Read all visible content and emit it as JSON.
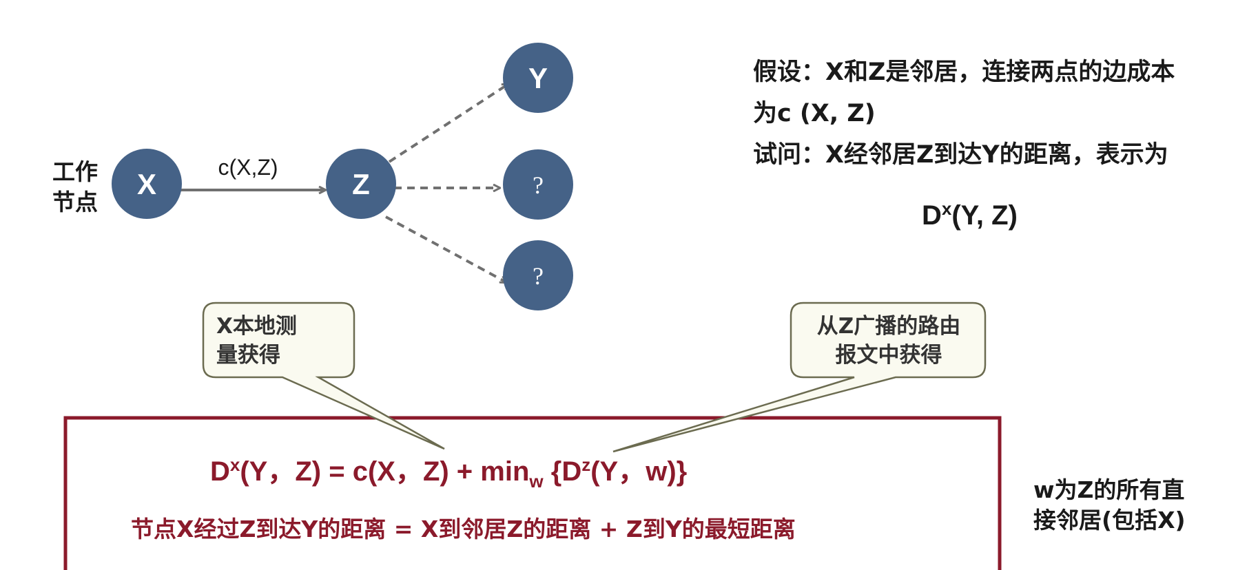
{
  "work_node_label": [
    "工作",
    "节点"
  ],
  "nodes": {
    "x": "X",
    "z": "Z",
    "y": "Y",
    "q1": "?",
    "q2": "?"
  },
  "edge_label": "c(X,Z)",
  "info": {
    "line1": "假设：X和Z是邻居，连接两点的边成本",
    "line2": "为c (X, Z)",
    "line3": "试问：X经邻居Z到达Y的距离，表示为"
  },
  "distance": {
    "base": "D",
    "sup": "x",
    "args": "(Y, Z)"
  },
  "callouts": {
    "local": [
      "X本地测",
      "量获得"
    ],
    "broadcast": [
      "从Z广播的路由",
      "报文中获得"
    ]
  },
  "formula": {
    "lhs_base": "D",
    "lhs_sup": "x",
    "lhs_args": "(Y，Z) = c(X，Z) + min",
    "sub": "w",
    "rhs_open": " {D",
    "rhs_sup": "z",
    "rhs_args": "(Y，w)}"
  },
  "formula_desc": "节点X经过Z到达Y的距离 = X到邻居Z的距离 + Z到Y的最短距离",
  "side_note": [
    "w为Z的所有直",
    "接邻居(包括X)"
  ],
  "colors": {
    "node_fill": "#456287",
    "arrow": "#707070",
    "formula_red": "#8b1a2b",
    "box_border": "#8b1a2b",
    "callout_fill": "#fafaf0",
    "callout_border": "#6b6b50"
  }
}
